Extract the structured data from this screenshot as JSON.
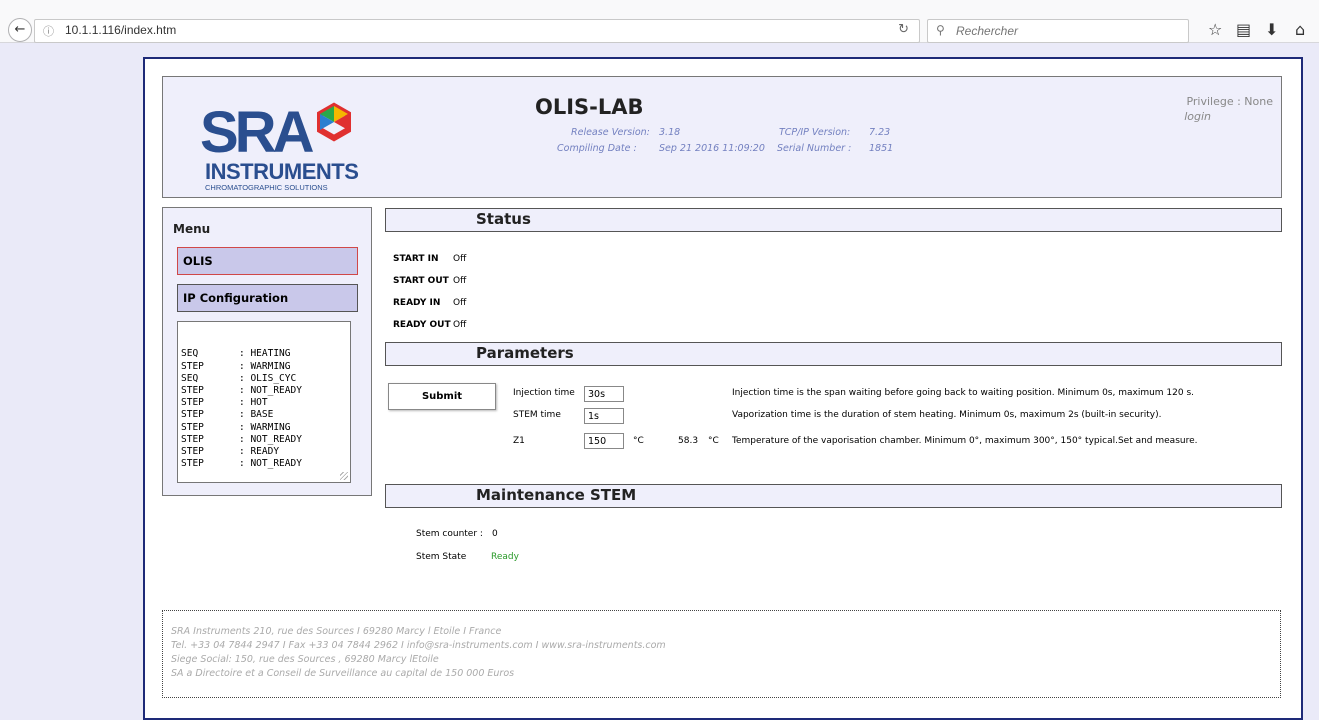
{
  "browser": {
    "url": "10.1.1.116/index.htm",
    "search_placeholder": "Rechercher"
  },
  "header": {
    "logo": {
      "text": "INSTRUMENTS",
      "sub": "CHROMATOGRAPHIC SOLUTIONS",
      "mark": "SRA"
    },
    "title": "OLIS-LAB",
    "release_label": "Release Version:",
    "release_value": "3.18",
    "tcpip_label": "TCP/IP Version:",
    "tcpip_value": "7.23",
    "compile_label": "Compiling Date :",
    "compile_value": "Sep 21 2016 11:09:20",
    "serial_label": "Serial Number :",
    "serial_value": "1851",
    "privilege": "Privilege : None",
    "login": "login"
  },
  "menu": {
    "title": "Menu",
    "items": [
      {
        "label": "OLIS",
        "active": true
      },
      {
        "label": "IP Configuration",
        "active": false
      }
    ],
    "log": [
      {
        "key": "SEQ",
        "value": "HEATING"
      },
      {
        "key": "STEP",
        "value": "WARMING"
      },
      {
        "key": "SEQ",
        "value": "OLIS_CYC"
      },
      {
        "key": "STEP",
        "value": "NOT_READY"
      },
      {
        "key": "STEP",
        "value": "HOT"
      },
      {
        "key": "STEP",
        "value": "BASE"
      },
      {
        "key": "STEP",
        "value": "WARMING"
      },
      {
        "key": "STEP",
        "value": "NOT_READY"
      },
      {
        "key": "STEP",
        "value": "READY"
      },
      {
        "key": "STEP",
        "value": "NOT_READY"
      }
    ]
  },
  "status": {
    "title": "Status",
    "rows": [
      {
        "label": "START IN",
        "value": "Off"
      },
      {
        "label": "START OUT",
        "value": "Off"
      },
      {
        "label": "READY IN",
        "value": "Off"
      },
      {
        "label": "READY OUT",
        "value": "Off"
      }
    ]
  },
  "parameters": {
    "title": "Parameters",
    "submit": "Submit",
    "rows": [
      {
        "label": "Injection time",
        "value": "30s",
        "unit": "",
        "measure": "",
        "measure_unit": "",
        "desc": "Injection time is the span waiting before going back to waiting position. Minimum 0s, maximum 120 s."
      },
      {
        "label": "STEM time",
        "value": "1s",
        "unit": "",
        "measure": "",
        "measure_unit": "",
        "desc": "Vaporization time is the duration of stem heating. Minimum 0s, maximum 2s (built-in security)."
      },
      {
        "label": "Z1",
        "value": "150",
        "unit": "°C",
        "measure": "58.3",
        "measure_unit": "°C",
        "desc": "Temperature of the vaporisation chamber. Minimum 0°, maximum 300°, 150° typical.Set and measure."
      }
    ]
  },
  "maintenance": {
    "title": "Maintenance STEM",
    "counter_label": "Stem counter :",
    "counter_value": "0",
    "state_label": "Stem State",
    "state_value": "Ready",
    "state_color": "#2a9a2a"
  },
  "footer": {
    "lines": [
      "SRA Instruments 210, rue des Sources I 69280 Marcy l Etoile I France",
      "Tel. +33 04 7844 2947 I Fax +33 04 7844 2962 I info@sra-instruments.com I www.sra-instruments.com",
      "Siege Social: 150, rue des Sources , 69280 Marcy lEtoile",
      "SA a Directoire et a Conseil de Surveillance au capital de 150 000 Euros"
    ]
  },
  "colors": {
    "frame": "#1e2a78",
    "panel": "#efeffb",
    "menu_button": "#c9c8ea",
    "accent_border": "#d04848"
  }
}
